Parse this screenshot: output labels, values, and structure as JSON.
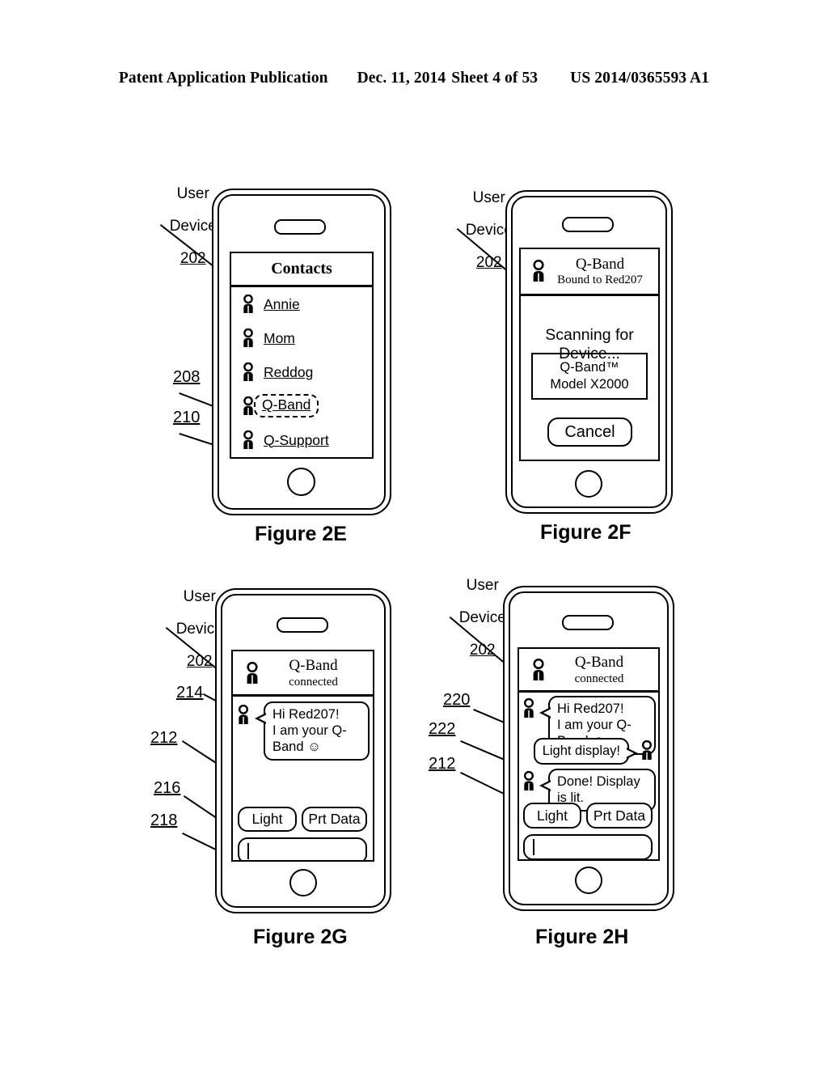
{
  "header": {
    "title": "Patent Application Publication",
    "date": "Dec. 11, 2014",
    "sheet": "Sheet 4 of 53",
    "publication_number": "US 2014/0365593 A1"
  },
  "figures": [
    {
      "id": "2E",
      "caption": "Figure 2E",
      "device_label": {
        "line1": "User",
        "line2": "Device",
        "number": "202"
      },
      "reference_numerals": [
        "208",
        "210"
      ],
      "screen": {
        "title": "Contacts",
        "contacts": [
          {
            "name": "Annie",
            "highlighted": false
          },
          {
            "name": "Mom",
            "highlighted": false
          },
          {
            "name": "Reddog",
            "highlighted": false
          },
          {
            "name": "Q-Band",
            "highlighted": true
          },
          {
            "name": "Q-Support",
            "highlighted": false
          }
        ]
      }
    },
    {
      "id": "2F",
      "caption": "Figure 2F",
      "device_label": {
        "line1": "User",
        "line2": "Device",
        "number": "202"
      },
      "reference_numerals": [],
      "screen": {
        "header_name": "Q-Band",
        "header_status": "Bound to Red207",
        "status_text": "Scanning for Device...",
        "device_found": {
          "line1": "Q-Band™",
          "line2": "Model X2000"
        },
        "cancel_label": "Cancel"
      }
    },
    {
      "id": "2G",
      "caption": "Figure 2G",
      "device_label": {
        "line1": "User",
        "line2": "Device",
        "number": "202"
      },
      "reference_numerals": [
        "214",
        "212",
        "216",
        "218"
      ],
      "screen": {
        "header_name": "Q-Band",
        "header_status": "connected",
        "messages": [
          {
            "side": "left",
            "line1": "Hi Red207!",
            "line2": "I am your Q-Band ☺"
          }
        ],
        "buttons": [
          "Light",
          "Prt Data"
        ],
        "input_value": ""
      }
    },
    {
      "id": "2H",
      "caption": "Figure 2H",
      "device_label": {
        "line1": "User",
        "line2": "Device",
        "number": "202"
      },
      "reference_numerals": [
        "220",
        "222",
        "212"
      ],
      "screen": {
        "header_name": "Q-Band",
        "header_status": "connected",
        "messages": [
          {
            "side": "left",
            "line1": "Hi Red207!",
            "line2": "I am your Q-Band ☺"
          },
          {
            "side": "right",
            "line1": "Light display!",
            "line2": ""
          },
          {
            "side": "left",
            "line1": "Done! Display is lit.",
            "line2": ""
          }
        ],
        "buttons": [
          "Light",
          "Prt Data"
        ],
        "input_value": ""
      }
    }
  ],
  "icons": {
    "contact": "person-icon",
    "avatar": "person-avatar-icon"
  },
  "colors": {
    "line": "#000000",
    "background": "#ffffff"
  }
}
